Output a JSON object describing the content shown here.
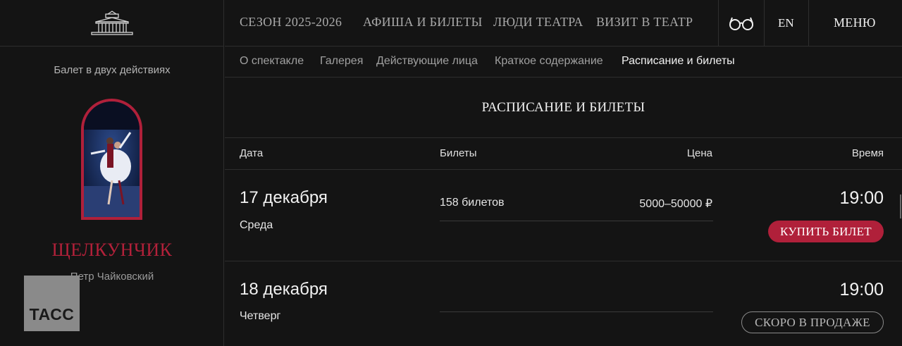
{
  "header": {
    "nav": [
      "СЕЗОН 2025-2026",
      "АФИША И БИЛЕТЫ",
      "ЛЮДИ ТЕАТРА",
      "ВИЗИТ В ТЕАТР"
    ],
    "lang": "EN",
    "menu": "МЕНЮ",
    "accessibility_icon": "glasses-icon",
    "logo_icon": "theatre-building-icon"
  },
  "performance": {
    "genre": "Балет в двух действиях",
    "title": "ЩЕЛКУНЧИК",
    "composer": "Петр Чайковский",
    "watermark": "ТАСС"
  },
  "tabs": [
    {
      "label": "О спектакле",
      "active": false
    },
    {
      "label": "Галерея",
      "active": false
    },
    {
      "label": "Действующие лица",
      "active": false
    },
    {
      "label": "Краткое содержание",
      "active": false
    },
    {
      "label": "Расписание и билеты",
      "active": true
    }
  ],
  "schedule": {
    "title": "РАСПИСАНИЕ И БИЛЕТЫ",
    "columns": {
      "date": "Дата",
      "tickets": "Билеты",
      "price": "Цена",
      "time": "Время"
    },
    "rows": [
      {
        "date": "17 декабря",
        "weekday": "Среда",
        "tickets": "158 билетов",
        "price": "5000–50000 ₽",
        "time": "19:00",
        "action": "КУПИТЬ БИЛЕТ",
        "action_type": "buy"
      },
      {
        "date": "18 декабря",
        "weekday": "Четверг",
        "tickets": "",
        "price": "",
        "time": "19:00",
        "action": "СКОРО В ПРОДАЖЕ",
        "action_type": "soon"
      }
    ]
  },
  "colors": {
    "accent": "#b0203a",
    "background": "#141414",
    "text": "#f2f2f2",
    "muted": "#a0a0a0"
  }
}
